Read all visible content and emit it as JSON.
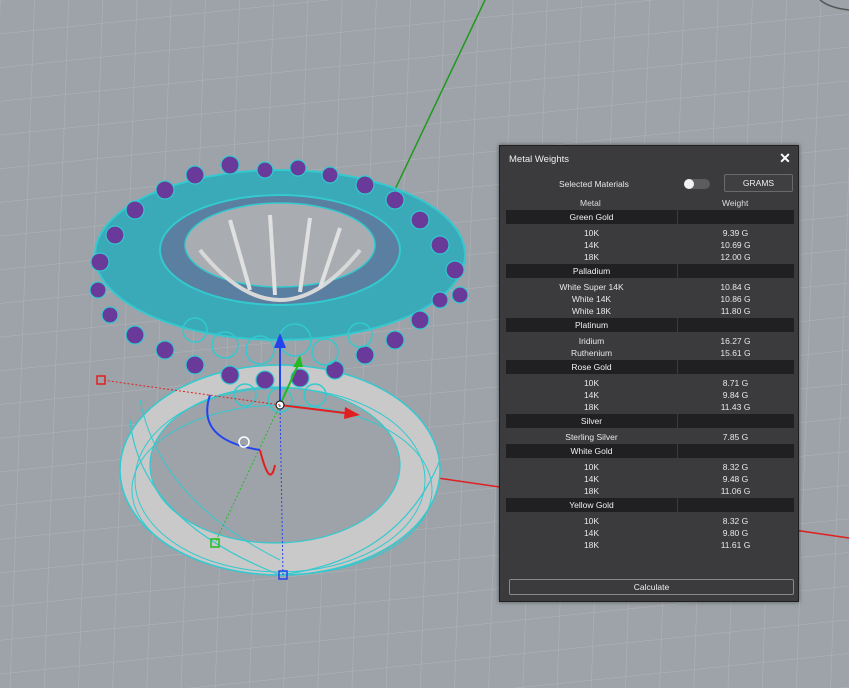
{
  "panel": {
    "title": "Metal Weights",
    "close_icon": "close-icon",
    "selected_materials_label": "Selected Materials",
    "units_button": "GRAMS",
    "col_metal": "Metal",
    "col_weight": "Weight",
    "calculate_label": "Calculate"
  },
  "groups": [
    {
      "name": "Green Gold",
      "rows": [
        {
          "metal": "10K",
          "weight": "9.39 G"
        },
        {
          "metal": "14K",
          "weight": "10.69 G"
        },
        {
          "metal": "18K",
          "weight": "12.00 G"
        }
      ]
    },
    {
      "name": "Palladium",
      "rows": [
        {
          "metal": "White Super 14K",
          "weight": "10.84 G"
        },
        {
          "metal": "White 14K",
          "weight": "10.86 G"
        },
        {
          "metal": "White 18K",
          "weight": "11.80 G"
        }
      ]
    },
    {
      "name": "Platinum",
      "rows": [
        {
          "metal": "Iridium",
          "weight": "16.27 G"
        },
        {
          "metal": "Ruthenium",
          "weight": "15.61 G"
        }
      ]
    },
    {
      "name": "Rose Gold",
      "rows": [
        {
          "metal": "10K",
          "weight": "8.71 G"
        },
        {
          "metal": "14K",
          "weight": "9.84 G"
        },
        {
          "metal": "18K",
          "weight": "11.43 G"
        }
      ]
    },
    {
      "name": "Silver",
      "rows": [
        {
          "metal": "Sterling Silver",
          "weight": "7.85 G"
        }
      ]
    },
    {
      "name": "White Gold",
      "rows": [
        {
          "metal": "10K",
          "weight": "8.32 G"
        },
        {
          "metal": "14K",
          "weight": "9.48 G"
        },
        {
          "metal": "18K",
          "weight": "11.06 G"
        }
      ]
    },
    {
      "name": "Yellow Gold",
      "rows": [
        {
          "metal": "10K",
          "weight": "8.32 G"
        },
        {
          "metal": "14K",
          "weight": "9.80 G"
        },
        {
          "metal": "18K",
          "weight": "11.61 G"
        }
      ]
    }
  ],
  "colors": {
    "viewport_bg": "#9ea3a9",
    "grid_line": "#b4b8bd",
    "x_axis": "#e02020",
    "y_axis": "#1f9a1f",
    "wireframe": "#33c9cf",
    "gem_purple": "#6a3a9a",
    "panel_bg": "#3b3b3d"
  }
}
